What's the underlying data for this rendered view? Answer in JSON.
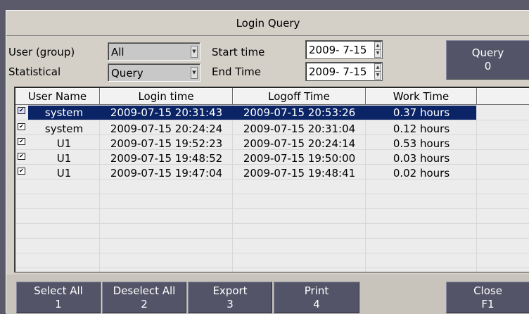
{
  "title": "Login Query",
  "filters": {
    "user_group_label": "User (group)",
    "user_group_value": "All",
    "statistical_label": "Statistical",
    "statistical_value": "Query",
    "start_label": "Start time",
    "start_value": "2009- 7-15",
    "end_label": "End Time",
    "end_value": "2009- 7-15"
  },
  "query_button": {
    "label": "Query",
    "hotkey": "0"
  },
  "table": {
    "columns": [
      "User Name",
      "Login time",
      "Logoff Time",
      "Work Time"
    ],
    "rows": [
      {
        "checked": true,
        "selected": true,
        "user": "system",
        "login": "2009-07-15 20:31:43",
        "logoff": "2009-07-15 20:53:26",
        "work": "0.37 hours"
      },
      {
        "checked": true,
        "selected": false,
        "user": "system",
        "login": "2009-07-15 20:24:24",
        "logoff": "2009-07-15 20:31:04",
        "work": "0.12 hours"
      },
      {
        "checked": true,
        "selected": false,
        "user": "U1",
        "login": "2009-07-15 19:52:23",
        "logoff": "2009-07-15 20:24:14",
        "work": "0.53 hours"
      },
      {
        "checked": true,
        "selected": false,
        "user": "U1",
        "login": "2009-07-15 19:48:52",
        "logoff": "2009-07-15 19:50:00",
        "work": "0.03 hours"
      },
      {
        "checked": true,
        "selected": false,
        "user": "U1",
        "login": "2009-07-15 19:47:04",
        "logoff": "2009-07-15 19:48:41",
        "work": "0.02 hours"
      }
    ]
  },
  "bottom_buttons": {
    "select_all": {
      "label": "Select All",
      "hotkey": "1"
    },
    "deselect_all": {
      "label": "Deselect All",
      "hotkey": "2"
    },
    "export": {
      "label": "Export",
      "hotkey": "3"
    },
    "print": {
      "label": "Print",
      "hotkey": "4"
    },
    "close": {
      "label": "Close",
      "hotkey": "F1"
    }
  },
  "icons": {
    "checkbox": "checkbox-checked-icon",
    "dropdown": "dropdown-arrow-icon",
    "spinner": "spinner-icon"
  }
}
